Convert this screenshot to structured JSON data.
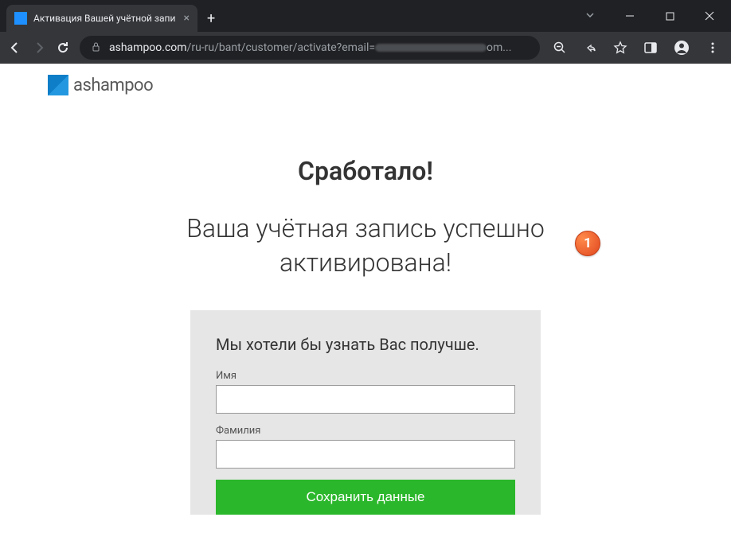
{
  "browser": {
    "tab_title": "Активация Вашей учётной запи",
    "url_domain": "ashampoo.com",
    "url_path_start": "/ru-ru/bant/customer/activate?email=",
    "url_path_end": "om..."
  },
  "site": {
    "brand_name": "ashampoo"
  },
  "page": {
    "title": "Сработало!",
    "subtitle": "Ваша учётная запись успешно активирована!",
    "badge_number": "1",
    "form": {
      "intro": "Мы хотели бы узнать Вас получше.",
      "first_name_label": "Имя",
      "first_name_value": "",
      "last_name_label": "Фамилия",
      "last_name_value": "",
      "submit_label": "Сохранить данные"
    }
  }
}
